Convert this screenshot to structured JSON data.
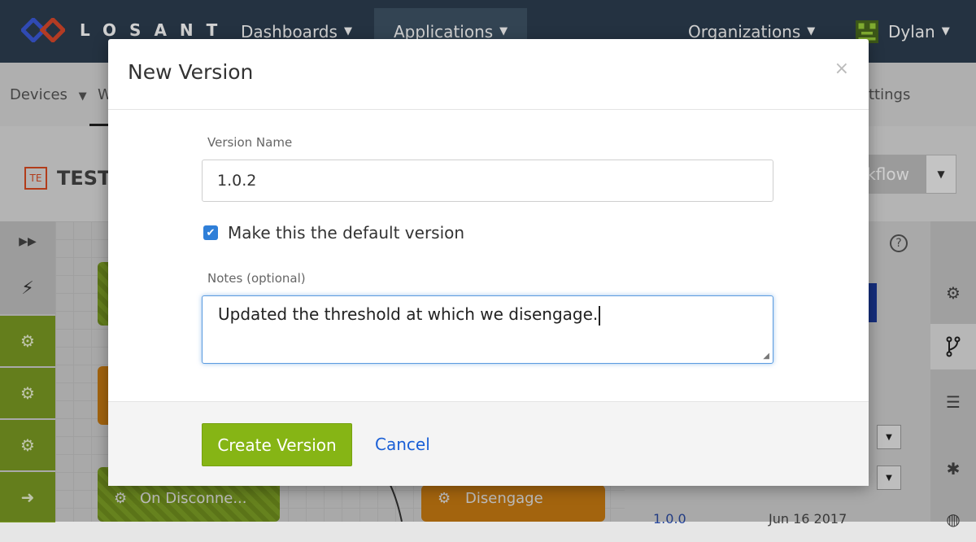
{
  "topbar": {
    "brand": "LOSANT",
    "nav": [
      {
        "label": "Dashboards"
      },
      {
        "label": "Applications"
      },
      {
        "label": "Organizations"
      }
    ],
    "user": "Dylan"
  },
  "subnav": {
    "devices": "Devices",
    "partial_left": "W",
    "partial_right": "ttings"
  },
  "app_header": {
    "badge": "TE",
    "name": "TESTA",
    "save_partial": "kflow"
  },
  "canvas": {
    "node_disconnect": "On Disconne...",
    "node_disengage": "Disengage"
  },
  "right_panel": {
    "help": "?",
    "row_version": "1.0.0",
    "row_date": "Jun 16 2017"
  },
  "modal": {
    "title": "New Version",
    "close": "×",
    "version_name_label": "Version Name",
    "version_name_value": "1.0.2",
    "default_checked": true,
    "default_label": "Make this the default version",
    "notes_label": "Notes (optional)",
    "notes_value": "Updated the threshold at which we disengage.",
    "create_label": "Create Version",
    "cancel_label": "Cancel"
  },
  "colors": {
    "topbar": "#2c3e50",
    "create_button": "#86b515",
    "link": "#1a5fd6",
    "checkbox": "#2f7fd8",
    "focus": "#5b9be0"
  }
}
